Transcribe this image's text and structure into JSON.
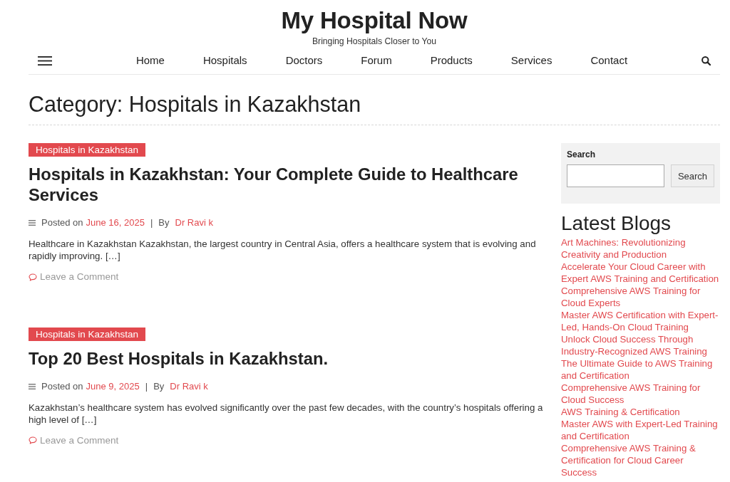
{
  "site": {
    "title": "My Hospital Now",
    "tagline": "Bringing Hospitals Closer to You"
  },
  "nav": {
    "items": [
      {
        "label": "Home"
      },
      {
        "label": "Hospitals"
      },
      {
        "label": "Doctors"
      },
      {
        "label": "Forum"
      },
      {
        "label": "Products"
      },
      {
        "label": "Services"
      },
      {
        "label": "Contact"
      }
    ]
  },
  "page_title": "Category: Hospitals in Kazakhstan",
  "posts": [
    {
      "category": "Hospitals in Kazakhstan",
      "title": "Hospitals in Kazakhstan: Your Complete Guide to Healthcare Services",
      "posted_on_label": "Posted on",
      "date": "June 16, 2025",
      "separator": "|",
      "by_label": "By",
      "author": "Dr Ravi k",
      "excerpt": "Healthcare in Kazakhstan Kazakhstan, the largest country in Central Asia, offers a healthcare system that is evolving and rapidly improving. […]",
      "comments_link": "Leave a Comment"
    },
    {
      "category": "Hospitals in Kazakhstan",
      "title": "Top 20 Best Hospitals in Kazakhstan.",
      "posted_on_label": "Posted on",
      "date": "June 9, 2025",
      "separator": "|",
      "by_label": "By",
      "author": "Dr Ravi k",
      "excerpt": "Kazakhstan’s healthcare system has evolved significantly over the past few decades, with the country’s hospitals offering a high level of […]",
      "comments_link": "Leave a Comment"
    }
  ],
  "sidebar": {
    "search": {
      "label": "Search",
      "button": "Search"
    },
    "latest_blogs": {
      "title": "Latest Blogs",
      "items": [
        "Art Machines: Revolutionizing Creativity and Production",
        "Accelerate Your Cloud Career with Expert AWS Training and Certification",
        "Comprehensive AWS Training for Cloud Experts",
        "Master AWS Certification with Expert-Led, Hands-On Cloud Training",
        "Unlock Cloud Success Through Industry-Recognized AWS Training",
        "The Ultimate Guide to AWS Training and Certification",
        "Comprehensive AWS Training for Cloud Success",
        "AWS Training & Certification",
        "Master AWS with Expert-Led Training and Certification",
        "Comprehensive AWS Training & Certification for Cloud Career Success"
      ]
    }
  }
}
